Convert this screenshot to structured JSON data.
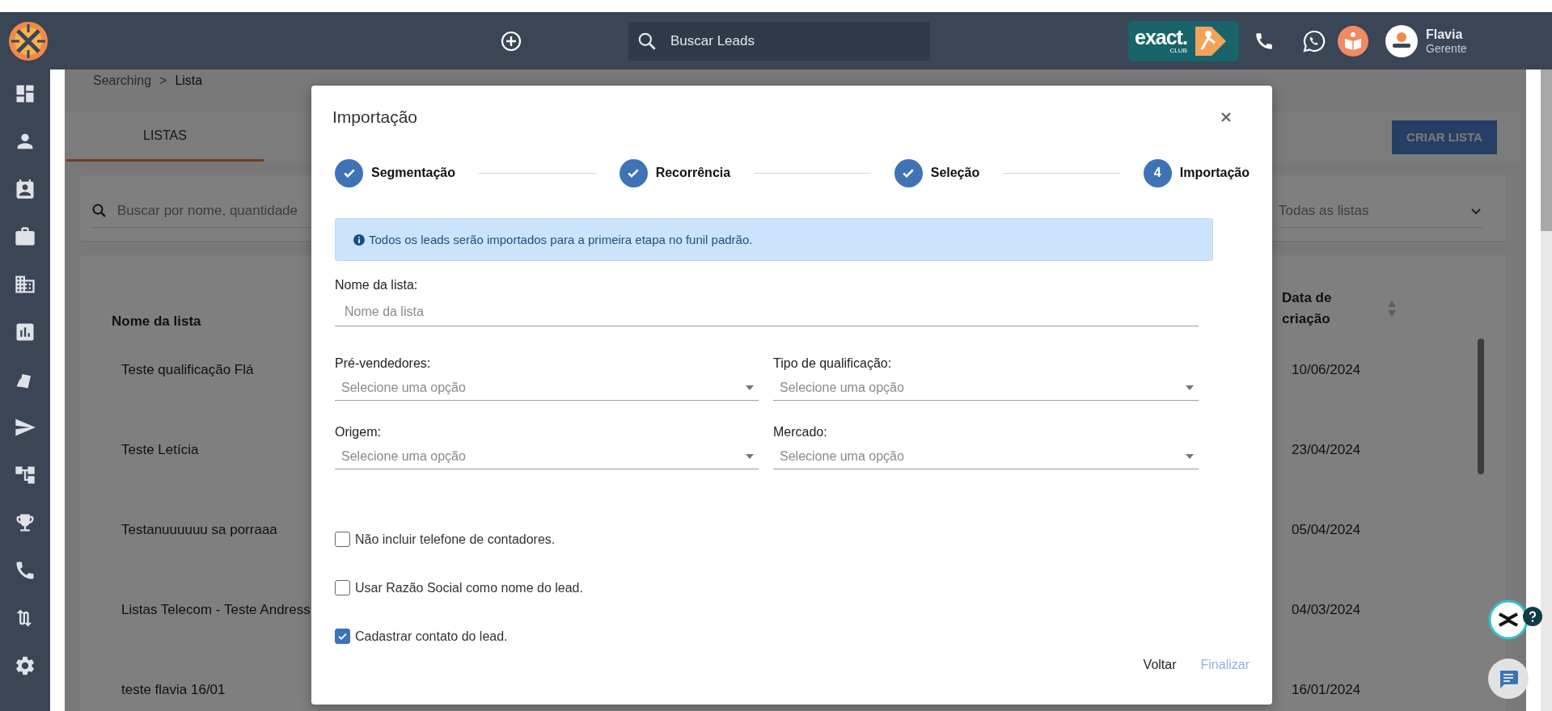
{
  "header": {
    "search": {
      "placeholder": "Buscar Leads"
    },
    "club_badge": {
      "brand": "exact.",
      "sub": "CLUB"
    },
    "user": {
      "name": "Flavia",
      "role": "Gerente"
    }
  },
  "sidebar": {
    "items": [
      {
        "kind": "dashboard"
      },
      {
        "kind": "person"
      },
      {
        "kind": "contact"
      },
      {
        "kind": "briefcase"
      },
      {
        "kind": "building"
      },
      {
        "kind": "chart"
      },
      {
        "kind": "cards"
      },
      {
        "kind": "send"
      },
      {
        "kind": "hierarchy"
      },
      {
        "kind": "trophy"
      },
      {
        "kind": "phone"
      },
      {
        "kind": "swap"
      },
      {
        "kind": "settings"
      }
    ]
  },
  "breadcrumb": {
    "items": [
      "Searching",
      "Lista"
    ],
    "separator": ">"
  },
  "tabs": [
    {
      "label": "LISTAS",
      "selected": true
    }
  ],
  "create_button": "CRIAR LISTA",
  "filter": {
    "search_placeholder": "Buscar por nome, quantidade",
    "list_filter": "Todas as listas"
  },
  "table": {
    "columns": [
      "Nome da lista",
      "Data de criação"
    ],
    "rows": [
      {
        "name": "Teste qualificação Flá",
        "date": "10/06/2024"
      },
      {
        "name": "Teste Letícia",
        "date": "23/04/2024"
      },
      {
        "name": "Testanuuuuuu sa porraaa",
        "date": "05/04/2024"
      },
      {
        "name": "Listas Telecom - Teste Andress",
        "date": "04/03/2024"
      },
      {
        "name": "teste flavia 16/01",
        "date": "16/01/2024"
      }
    ]
  },
  "modal": {
    "title": "Importação",
    "steps": [
      {
        "label": "Segmentação",
        "completed": true
      },
      {
        "label": "Recorrência",
        "completed": true
      },
      {
        "label": "Seleção",
        "completed": true
      },
      {
        "label": "Importação",
        "number": "4",
        "completed": false
      }
    ],
    "info": "Todos os leads serão importados para a primeira etapa no funil padrão.",
    "name_field": {
      "label": "Nome da lista:",
      "placeholder": "Nome da lista"
    },
    "selects": [
      {
        "label": "Pré-vendedores:",
        "placeholder": "Selecione uma opção"
      },
      {
        "label": "Tipo de qualificação:",
        "placeholder": "Selecione uma opção"
      },
      {
        "label": "Origem:",
        "placeholder": "Selecione uma opção"
      },
      {
        "label": "Mercado:",
        "placeholder": "Selecione uma opção"
      }
    ],
    "checkboxes": [
      {
        "label": "Não incluir telefone de contadores.",
        "checked": false
      },
      {
        "label": "Usar Razão Social como nome do lead.",
        "checked": false
      },
      {
        "label": "Cadastrar contato do lead.",
        "checked": true
      }
    ],
    "buttons": [
      {
        "label": "Voltar",
        "disabled": false
      },
      {
        "label": "Finalizar",
        "disabled": true
      }
    ]
  }
}
